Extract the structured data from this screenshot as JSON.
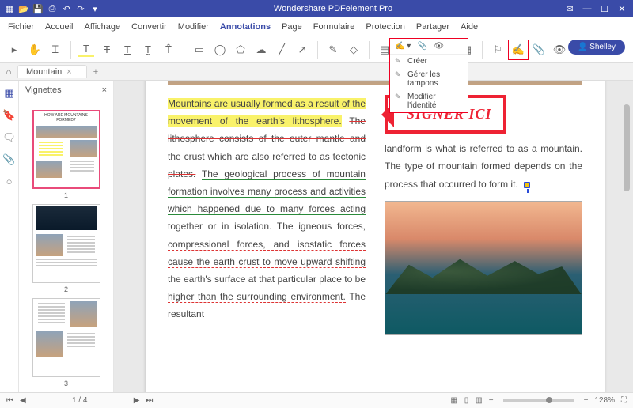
{
  "app": {
    "title": "Wondershare PDFelement Pro",
    "user": "Shelley"
  },
  "menus": [
    "Fichier",
    "Accueil",
    "Affichage",
    "Convertir",
    "Modifier",
    "Annotations",
    "Page",
    "Formulaire",
    "Protection",
    "Partager",
    "Aide"
  ],
  "active_menu": 5,
  "tab": {
    "name": "Mountain"
  },
  "panel": {
    "title": "Vignettes"
  },
  "thumbs": [
    {
      "num": "1",
      "title": "HOW ARE MOUNTAINS FORMED?",
      "selected": true
    },
    {
      "num": "2",
      "title": "",
      "selected": false
    },
    {
      "num": "3",
      "title": "",
      "selected": false
    }
  ],
  "dropdown": {
    "items": [
      "Créer",
      "Gérer les tampons",
      "Modifier l'identité"
    ]
  },
  "doc": {
    "stamp": "SIGNER ICI",
    "para1_hl": "Mountains are usually formed as a result of the movement of the earth's lithosphere.",
    "para1_strike": "The lithosphere consists of the outer mantle and the crust which are also referred to as tectonic plates.",
    "para1_undg": "The geological process of mountain formation involves many process and activities which happened due to many forces acting together or in isolation.",
    "para1_undr": "The igneous forces, compressional forces, and isostatic forces cause the earth crust to move upward shifting the earth's surface at that particular place to be higher than the surrounding environment.",
    "para1_tail": "The resultant",
    "para2": "landform is what is referred to as a mountain. The type of mountain formed depends on the process that occurred to form it."
  },
  "status": {
    "page": "1",
    "total": "4",
    "zoom": "128%"
  }
}
